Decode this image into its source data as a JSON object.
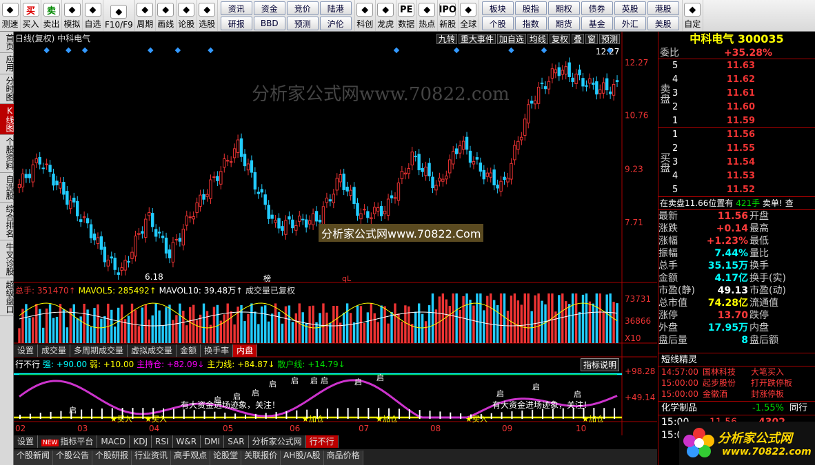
{
  "toolbar": {
    "singles": [
      {
        "label": "测速",
        "icon": "clock-icon"
      },
      {
        "label": "买入",
        "icon": "buy-icon",
        "glyph": "买"
      },
      {
        "label": "卖出",
        "icon": "sell-icon",
        "glyph": "卖"
      },
      {
        "label": "模拟",
        "icon": "hammer-icon"
      },
      {
        "label": "自选",
        "icon": "star-icon"
      },
      {
        "label": "F10/F9",
        "icon": "list-icon"
      },
      {
        "label": "周期",
        "icon": "cycle-icon"
      },
      {
        "label": "画线",
        "icon": "pencil-icon"
      },
      {
        "label": "论股",
        "icon": "discuss-icon"
      },
      {
        "label": "选股",
        "icon": "select-icon"
      }
    ],
    "grid1": [
      "资讯",
      "资金",
      "竞价",
      "陆港",
      "研报",
      "BBD",
      "预测",
      "沪伦"
    ],
    "mids": [
      {
        "label": "科创",
        "icon": "chart-icon"
      },
      {
        "label": "龙虎",
        "icon": "dragon-icon"
      },
      {
        "label": "数据",
        "icon": "pe-icon",
        "glyph": "PE"
      },
      {
        "label": "热点",
        "icon": "hot-icon"
      },
      {
        "label": "新股",
        "icon": "ipo-icon",
        "glyph": "IPO"
      },
      {
        "label": "全球",
        "icon": "globe-icon"
      }
    ],
    "grid2": [
      "板块",
      "股指",
      "期权",
      "债券",
      "英股",
      "港股",
      "个股",
      "指数",
      "期货",
      "基金",
      "外汇",
      "美股"
    ],
    "tail": {
      "label": "自定",
      "icon": "info-icon"
    }
  },
  "sidebar": [
    "首页",
    "应用",
    "分时图",
    "K线图",
    "个股资料",
    "自选股",
    "综合排名",
    "牛叉诊股",
    "超级盘口"
  ],
  "chart": {
    "title": "日线(复权)  中科电气",
    "tabs": [
      "九转",
      "重大事件",
      "加自选",
      "均线",
      "复权",
      "叠",
      "窗",
      "预测"
    ],
    "y_labels": [
      "12.27",
      "10.76",
      "9.23",
      "7.71"
    ],
    "high_label": "12.27",
    "low_label": "6.18",
    "mark1": "榜",
    "mark2": "qL",
    "vol_header": {
      "total": "总手: 351470↑",
      "ma5": "MAVOL5: 285492↑",
      "ma10": "MAVOL10: 39.48万↑",
      "note": "成交量已复权"
    },
    "vol_y": [
      "73731",
      "36866",
      "X10"
    ],
    "vol_tabs": [
      "设置",
      "成交量",
      "多周期成交量",
      "虚拟成交量",
      "金额",
      "换手率",
      "内盘"
    ],
    "ind_header": {
      "name": "行不行",
      "strong": "强: +90.00",
      "weak": "弱: +10.00",
      "main_hold": "主持仓: +82.09↓",
      "main": "主力线: +84.87↓",
      "retail": "散户线: +14.79↓",
      "btn": "指标说明"
    },
    "ind_y": [
      "+98.28",
      "+49.14"
    ],
    "ind_texts": [
      "有大资金进场迹象，关注！",
      "有大资金进场迹象，关注！"
    ],
    "ind_labels": [
      "启",
      "启",
      "启",
      "启",
      "启",
      "启",
      "启",
      "启",
      "启",
      "启",
      "启",
      "启"
    ],
    "buy_labels": [
      "买入",
      "加仓",
      "加仓",
      "买入",
      "加仓",
      "买入"
    ],
    "x_labels": [
      "02",
      "03",
      "04",
      "05",
      "06",
      "07",
      "08",
      "09",
      "10"
    ],
    "bottom_tabs": [
      "设置",
      "指标平台",
      "MACD",
      "KDJ",
      "RSI",
      "W&R",
      "DMI",
      "SAR",
      "分析家公式网",
      "行不行"
    ],
    "new_badge": "NEW",
    "news_tabs": [
      "个股新闻",
      "个股公告",
      "个股研报",
      "行业资讯",
      "高手观点",
      "论股堂",
      "关联报价",
      "AH股/A股",
      "商品价格"
    ]
  },
  "watermark": "分析家公式网www.70822.com",
  "watermark2": "分析家公式网www.70822.Com",
  "quote": {
    "name": "中科电气",
    "code": "300035",
    "wb_label": "委比",
    "wb": "+35.28%",
    "sell_label": "卖盘",
    "buy_label": "买盘",
    "sell": [
      {
        "n": "5",
        "p": "11.63"
      },
      {
        "n": "4",
        "p": "11.62"
      },
      {
        "n": "3",
        "p": "11.61"
      },
      {
        "n": "2",
        "p": "11.60"
      },
      {
        "n": "1",
        "p": "11.59"
      }
    ],
    "buy": [
      {
        "n": "1",
        "p": "11.56"
      },
      {
        "n": "2",
        "p": "11.55"
      },
      {
        "n": "3",
        "p": "11.54"
      },
      {
        "n": "4",
        "p": "11.53"
      },
      {
        "n": "5",
        "p": "11.52"
      }
    ],
    "alert": "在卖盘11.66位置有",
    "alert_v": "421手",
    "alert_t": "卖单!",
    "alert_x": "查",
    "stats": [
      {
        "k": "最新",
        "v": "11.56",
        "k2": "开盘"
      },
      {
        "k": "涨跌",
        "v": "+0.14",
        "k2": "最高"
      },
      {
        "k": "涨幅",
        "v": "+1.23%",
        "k2": "最低"
      },
      {
        "k": "振幅",
        "v": "7.44%",
        "k2": "量比"
      },
      {
        "k": "总手",
        "v": "35.15万",
        "k2": "换手"
      },
      {
        "k": "金额",
        "v": "4.17亿",
        "k2": "换手(实)"
      },
      {
        "k": "市盈(静)",
        "v": "49.13",
        "k2": "市盈(动)"
      },
      {
        "k": "总市值",
        "v": "74.28亿",
        "k2": "流通值"
      },
      {
        "k": "涨停",
        "v": "13.70",
        "k2": "跌停"
      },
      {
        "k": "外盘",
        "v": "17.95万",
        "k2": "内盘"
      },
      {
        "k": "盘后量",
        "v": "8",
        "k2": "盘后额"
      }
    ],
    "news_title": "短线精灵",
    "news": [
      {
        "t": "14:57:00",
        "a": "国林科技",
        "b": "大笔买入"
      },
      {
        "t": "15:00:00",
        "a": "起步股份",
        "b": "打开跌停板"
      },
      {
        "t": "15:00:00",
        "a": "金徽酒",
        "b": "封涨停板"
      }
    ],
    "sector": "化学制品",
    "sector_pct": "-1.55%",
    "sector_link": "同行",
    "tick_time": "15:00",
    "tick_price": "11.56",
    "tick_vol": "4302",
    "tick2": "15:0"
  },
  "logo_text": "分析家公式网",
  "logo_url": "www.70822.com"
}
